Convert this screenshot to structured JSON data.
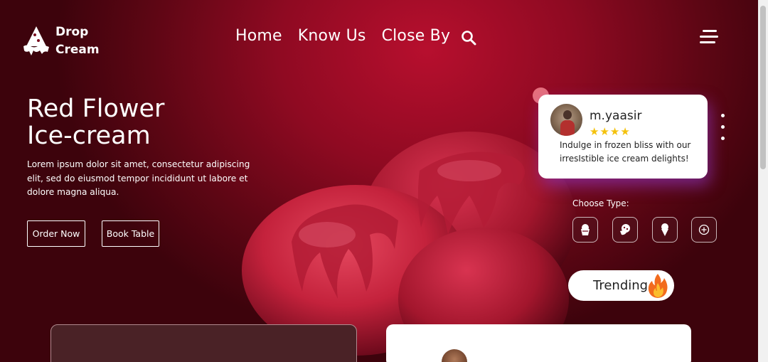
{
  "brand": {
    "line1": "Drop",
    "line2": "Cream"
  },
  "nav": {
    "home": "Home",
    "know_us": "Know Us",
    "close_by": "Close By"
  },
  "hero": {
    "title_line1": "Red Flower",
    "title_line2": "Ice-cream",
    "description": "Lorem ipsum dolor sit amet, consectetur adipiscing elit, sed do eiusmod tempor incididunt ut labore et dolore magna aliqua.",
    "order_label": "Order Now",
    "book_label": "Book Table"
  },
  "review": {
    "name": "m.yaasir",
    "stars": "★★★★",
    "rating": 4,
    "text": "Indulge in frozen bliss with our irresIstible ice cream delights!"
  },
  "types": {
    "label": "Choose Type:",
    "icons": [
      "cup-icon",
      "scoop-icon",
      "cone-icon",
      "plus-icon"
    ]
  },
  "trending": {
    "label": "Trending"
  },
  "colors": {
    "accent": "#b70f2e",
    "dark": "#3d030c",
    "star": "#f4c20d",
    "dot": "#e5707d"
  }
}
